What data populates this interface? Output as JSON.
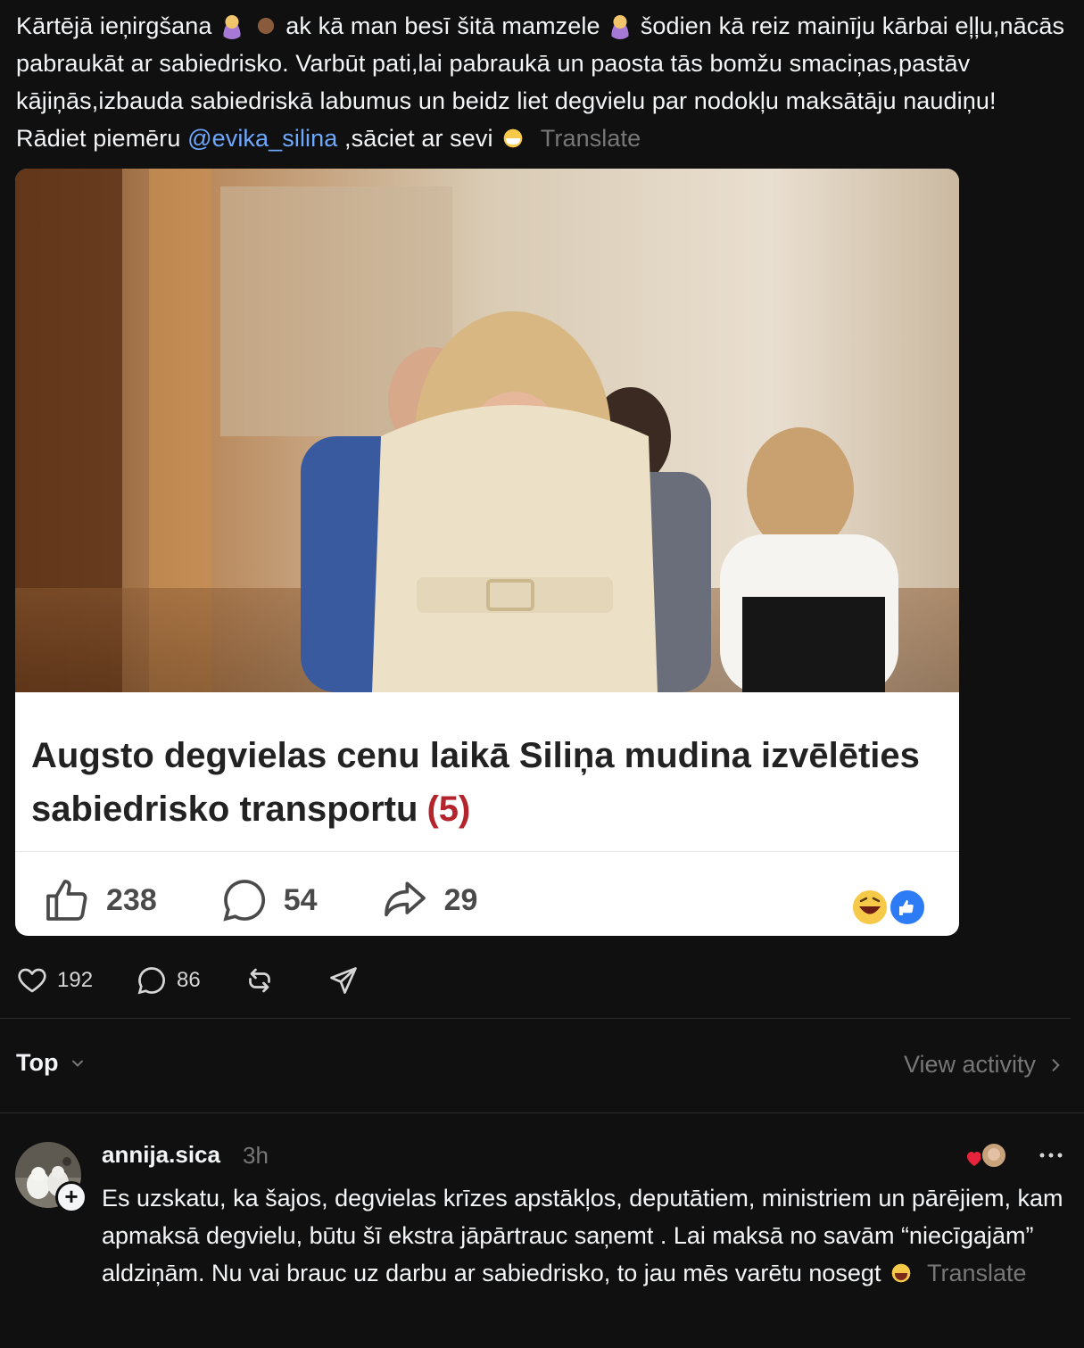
{
  "post": {
    "text_1": "Kārtējā ieņirgšana",
    "text_2": "ak kā man besī šitā mamzele",
    "text_3": " šodien kā reiz mainīju kārbai eļļu,nācās pabraukāt ar sabiedrisko. Varbūt pati,lai pabraukā un paosta tās bomžu smaciņas,pastāv kājiņās,izbauda sabiedriskā labumus un beidz liet degvielu par nodokļu maksātāju naudiņu! Rādiet piemēru ",
    "mention": "@evika_silina",
    "text_4": " ,sāciet ar sevi",
    "translate": "Translate",
    "emojis": [
      "person-facepalming",
      "see-no-evil-monkey",
      "person-facepalming",
      "grinning-face"
    ]
  },
  "card": {
    "headline": "Augsto degvielas cenu laikā Siliņa mudina izvēlēties sabiedrisko transportu",
    "count": "(5)",
    "likes": "238",
    "comments": "54",
    "shares": "29",
    "reactions": [
      "laughing-face",
      "like-thumb"
    ]
  },
  "actions": {
    "likes": "192",
    "replies": "86"
  },
  "sort": {
    "label": "Top"
  },
  "view_activity": "View activity",
  "comment": {
    "username": "annija.sica",
    "time": "3h",
    "text": "Es uzskatu, ka šajos, degvielas krīzes apstākļos, deputātiem, ministriem un pārējiem, kam apmaksā degvielu, būtu šī ekstra jāpārtrauc saņemt . Lai maksā no savām “niecīgajām” aldziņām. Nu vai brauc uz darbu ar sabiedrisko, to jau mēs varētu nosegt ",
    "translate": "Translate"
  },
  "colors": {
    "background": "#101010",
    "mention": "#6ea8fe",
    "muted": "#777777",
    "headline_count": "#b3242c",
    "like_heart": "#e8243c"
  }
}
